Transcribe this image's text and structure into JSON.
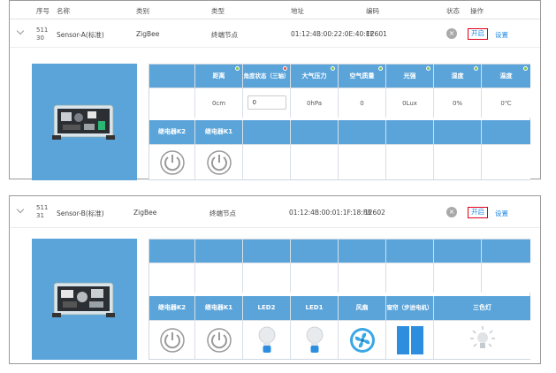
{
  "table_headers": [
    "序号",
    "名称",
    "类别",
    "类型",
    "地址",
    "编码",
    "状态",
    "操作"
  ],
  "colors": {
    "accent": "#1e88e5",
    "header_blue": "#5aa4da",
    "highlight_red": "#e0001b",
    "dot_green": "#7dc242",
    "dot_red": "#e74c3c"
  },
  "devices": [
    {
      "index_line1": "511",
      "index_line2": "30",
      "name": "Sensor-A(标准)",
      "category": "ZigBee",
      "type": "终端节点",
      "address": "01:12:4B:00:22:0E:40:EE",
      "code": "12601",
      "status_icon": "close-icon",
      "op_open": "开启",
      "op_set": "设置",
      "sensor_headers": [
        "距离",
        "角度状态（三轴）",
        "大气压力",
        "空气质量",
        "光强",
        "湿度",
        "温度"
      ],
      "sensor_dots": [
        "dot_green",
        "dot_red",
        "dot_green",
        "dot_green",
        "dot_green",
        "dot_green",
        "dot_green"
      ],
      "sensor_values": [
        "0cm",
        "0",
        "0hPa",
        "0",
        "0Lux",
        "0%",
        "0℃"
      ],
      "actuator_headers": [
        "继电器K2",
        "继电器K1",
        "",
        "",
        "",
        "",
        ""
      ],
      "actuator_icons": [
        "power-icon",
        "power-icon",
        "",
        "",
        "",
        "",
        ""
      ]
    },
    {
      "index_line1": "511",
      "index_line2": "31",
      "name": "Sensor-B(标准)",
      "category": "ZigBee",
      "type": "终端节点",
      "address": "01:12:4B:00:01:1F:18:F8",
      "code": "12602",
      "status_icon": "close-icon",
      "op_open": "开启",
      "op_set": "设置",
      "sensor_headers": [
        "",
        "",
        "",
        "",
        "",
        "",
        ""
      ],
      "sensor_values": [
        "",
        "",
        "",
        "",
        "",
        "",
        ""
      ],
      "actuator_headers": [
        "继电器K2",
        "继电器K1",
        "LED2",
        "LED1",
        "风扇",
        "窗帘（步进电机）",
        "三色灯"
      ],
      "actuator_icons": [
        "power-icon",
        "power-icon",
        "bulb-icon",
        "bulb-icon",
        "fan-icon",
        "curtain-icon",
        "rgb-light-icon"
      ]
    }
  ]
}
